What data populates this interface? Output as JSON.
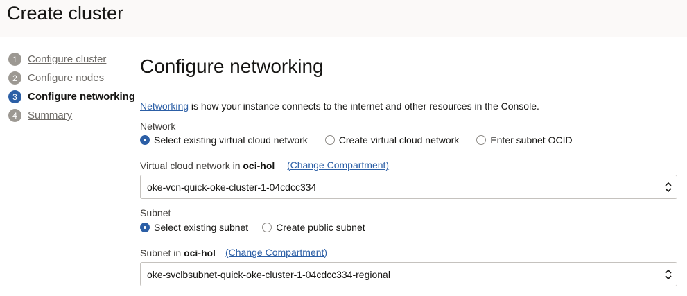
{
  "header": {
    "title": "Create cluster"
  },
  "steps": [
    {
      "number": "1",
      "label": "Configure cluster",
      "active": false
    },
    {
      "number": "2",
      "label": "Configure nodes",
      "active": false
    },
    {
      "number": "3",
      "label": "Configure networking",
      "active": true
    },
    {
      "number": "4",
      "label": "Summary",
      "active": false
    }
  ],
  "section": {
    "title": "Configure networking",
    "intro_link": "Networking",
    "intro_text": " is how your instance connects to the internet and other resources in the Console."
  },
  "network": {
    "label": "Network",
    "options": [
      "Select existing virtual cloud network",
      "Create virtual cloud network",
      "Enter subnet OCID"
    ],
    "selected_index": 0
  },
  "vcn": {
    "label_prefix": "Virtual cloud network in ",
    "compartment": "oci-hol",
    "change_link": "(Change Compartment)",
    "value": "oke-vcn-quick-oke-cluster-1-04cdcc334"
  },
  "subnet": {
    "label": "Subnet",
    "options": [
      "Select existing subnet",
      "Create public subnet"
    ],
    "selected_index": 0
  },
  "subnet_select": {
    "label_prefix": "Subnet in ",
    "compartment": "oci-hol",
    "change_link": "(Change Compartment)",
    "value": "oke-svclbsubnet-quick-oke-cluster-1-04cdcc334-regional"
  },
  "colors": {
    "accent": "#2c5fa6",
    "step_inactive": "#9c9892",
    "header_bg": "#fbf9f8"
  }
}
